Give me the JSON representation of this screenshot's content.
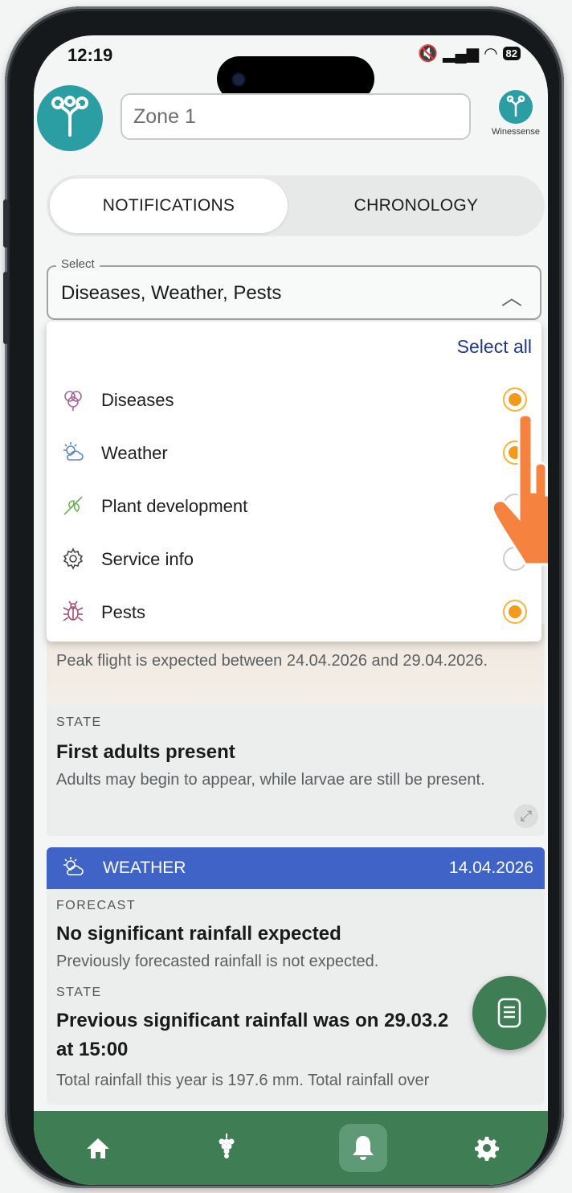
{
  "status_bar": {
    "time": "12:19",
    "battery": "82"
  },
  "header": {
    "zone_value": "Zone 1",
    "brand_name": "Winessense"
  },
  "tabs": [
    {
      "label": "NOTIFICATIONS",
      "active": true
    },
    {
      "label": "CHRONOLOGY",
      "active": false
    }
  ],
  "select": {
    "legend": "Select",
    "value": "Diseases, Weather, Pests",
    "select_all": "Select all",
    "options": [
      {
        "label": "Diseases",
        "icon": "diseases-icon",
        "selected": true
      },
      {
        "label": "Weather",
        "icon": "weather-icon",
        "selected": true
      },
      {
        "label": "Plant development",
        "icon": "plant-icon",
        "selected": false
      },
      {
        "label": "Service info",
        "icon": "gear-icon",
        "selected": false
      },
      {
        "label": "Pests",
        "icon": "bug-icon",
        "selected": true
      }
    ]
  },
  "pest_card": {
    "peak_text": "Peak flight is expected between 24.04.2026 and 29.04.2026.",
    "state_label": "STATE",
    "state_title": "First adults present",
    "state_body": "Adults may begin to appear, while larvae are still be present."
  },
  "weather_card": {
    "header_label": "WEATHER",
    "header_date": "14.04.2026",
    "header_color": "#3f63c7",
    "forecast_label": "FORECAST",
    "forecast_title": "No significant rainfall expected",
    "forecast_body": "Previously forecasted rainfall is not expected.",
    "state_label": "STATE",
    "state_title": "Previous significant rainfall was on 29.03.2",
    "state_title_2": "at 15:00",
    "state_body": "Total rainfall this year is 197.6 mm. Total rainfall over"
  },
  "bottom_nav": [
    {
      "icon": "home-icon",
      "active": false
    },
    {
      "icon": "grapes-icon",
      "active": false
    },
    {
      "icon": "bell-icon",
      "active": true
    },
    {
      "icon": "gear-icon",
      "active": false
    }
  ],
  "colors": {
    "brand_teal": "#2a9ea3",
    "nav_green": "#3f7d55",
    "radio_orange": "#f29b1a",
    "weather_blue": "#3f63c7",
    "select_all_blue": "#1e3a8a"
  }
}
